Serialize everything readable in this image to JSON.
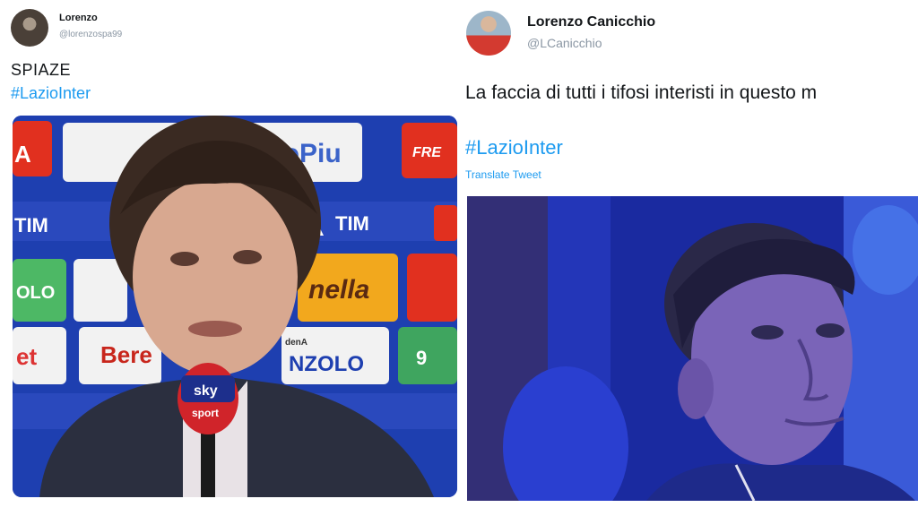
{
  "left_tweet": {
    "author_name": "Lorenzo",
    "author_handle": "@lorenzospa99",
    "text": "SPIAZE",
    "hashtag": "#LazioInter",
    "photo_signage": {
      "tile_1": "A",
      "tile_2": "roPiu",
      "tile_3": "FRE",
      "tile_4": "TIM",
      "tile_5": "TIM",
      "tile_6": "OLO",
      "tile_7": "nella",
      "tile_8": "et",
      "tile_9": "Bere",
      "tile_10": "NZOLO",
      "tile_11": "denA",
      "tile_12": "9",
      "mic_brand_1": "sky",
      "mic_brand_2": "sport"
    }
  },
  "right_tweet": {
    "more_indicator": "...",
    "author_name": "Lorenzo Canicchio",
    "author_handle": "@LCanicchio",
    "text": "La faccia di tutti i tifosi interisti in questo m",
    "hashtag": "#LazioInter",
    "translate_link": "Translate Tweet"
  },
  "colors": {
    "hashtag_blue": "#1d9bf0",
    "handle_gray": "#8a96a3",
    "name_text": "#14171a"
  }
}
